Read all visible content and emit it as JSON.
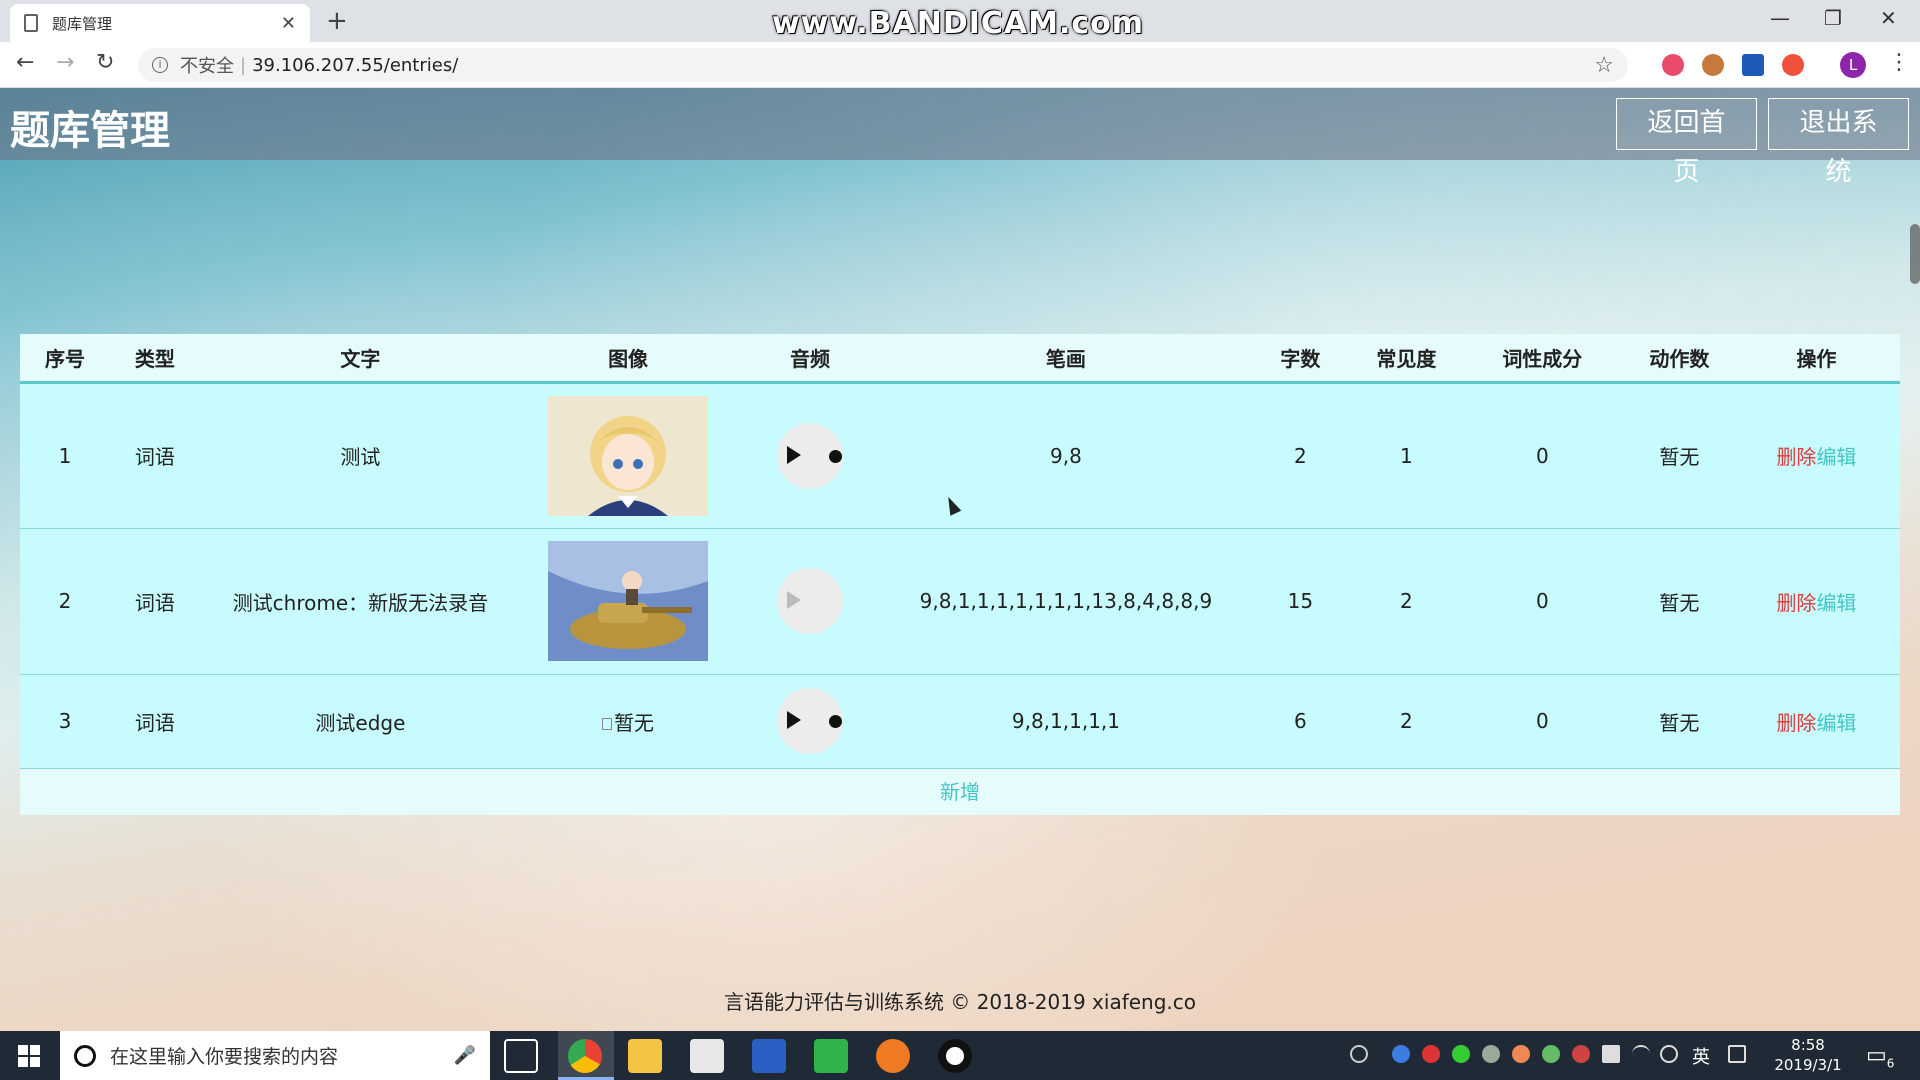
{
  "browser": {
    "tab_title": "题库管理",
    "watermark": "www.BANDICAM.com",
    "security_label": "不安全",
    "url": "39.106.207.55/entries/",
    "profile_initial": "L"
  },
  "header": {
    "title": "题库管理",
    "home_button": "返回首页",
    "logout_button": "退出系统"
  },
  "table": {
    "columns": [
      "序号",
      "类型",
      "文字",
      "图像",
      "音频",
      "笔画",
      "字数",
      "常见度",
      "词性成分",
      "动作数",
      "操作"
    ],
    "rows": [
      {
        "index": "1",
        "type": "词语",
        "text": "测试",
        "image": "thumbnail",
        "audio": "enabled",
        "strokes": "9,8",
        "char_count": "2",
        "frequency": "1",
        "pos": "0",
        "actions": "暂无",
        "delete": "删除",
        "edit": "编辑"
      },
      {
        "index": "2",
        "type": "词语",
        "text": "测试chrome：新版无法录音",
        "image": "thumbnail",
        "audio": "disabled",
        "strokes": "9,8,1,1,1,1,1,1,1,13,8,4,8,8,9",
        "char_count": "15",
        "frequency": "2",
        "pos": "0",
        "actions": "暂无",
        "delete": "删除",
        "edit": "编辑"
      },
      {
        "index": "3",
        "type": "词语",
        "text": "测试edge",
        "image": "暂无",
        "audio": "enabled",
        "strokes": "9,8,1,1,1,1",
        "char_count": "6",
        "frequency": "2",
        "pos": "0",
        "actions": "暂无",
        "delete": "删除",
        "edit": "编辑"
      }
    ],
    "add_label": "新增"
  },
  "footer": {
    "text": "言语能力评估与训练系统 © 2018-2019 xiafeng.co"
  },
  "taskbar": {
    "search_placeholder": "在这里输入你要搜索的内容",
    "ime": "英",
    "time": "8:58",
    "date": "2019/3/1",
    "notification_count": "6"
  }
}
